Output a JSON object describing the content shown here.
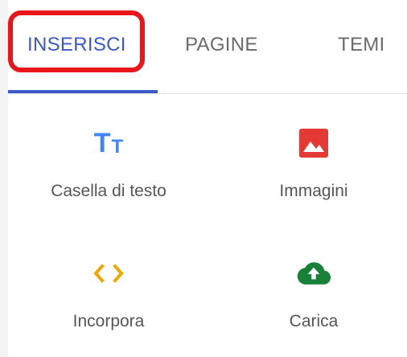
{
  "tabs": {
    "inserisci": "INSERISCI",
    "pagine": "PAGINE",
    "temi": "TEMI"
  },
  "tools": {
    "casella": {
      "label": "Casella di testo",
      "icon": "text-icon"
    },
    "immagini": {
      "label": "Immagini",
      "icon": "image-icon"
    },
    "incorpora": {
      "label": "Incorpora",
      "icon": "embed-code-icon"
    },
    "carica": {
      "label": "Carica",
      "icon": "cloud-upload-icon"
    }
  },
  "colors": {
    "accent": "#3b59c9",
    "highlight": "#e8161b",
    "text_icon": "#4285f4",
    "image_icon": "#e53935",
    "embed_icon": "#f4a600",
    "upload_icon": "#188038"
  }
}
